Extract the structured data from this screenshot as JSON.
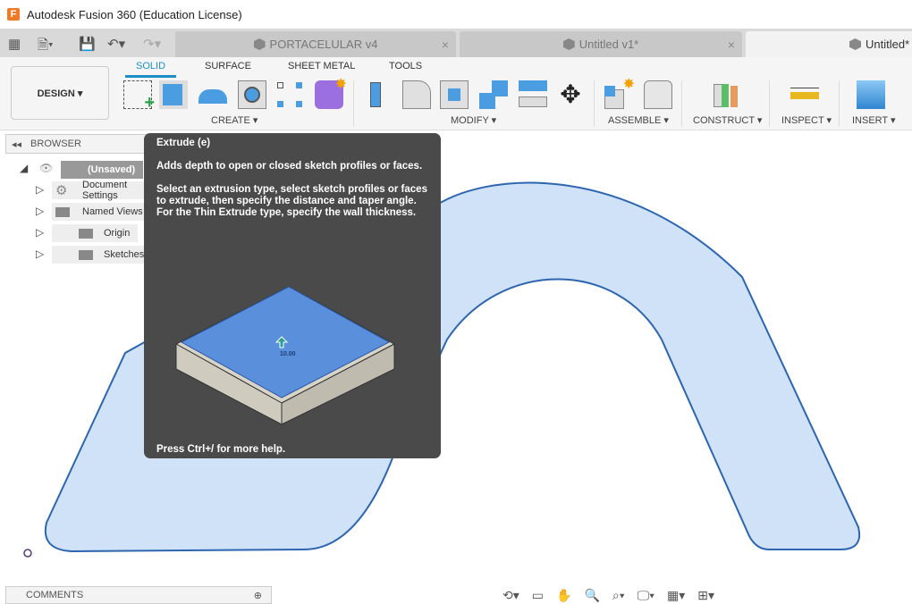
{
  "window": {
    "title": "Autodesk Fusion 360 (Education License)",
    "logo": "F"
  },
  "tabs": [
    {
      "label": "PORTACELULAR v4",
      "close": "×"
    },
    {
      "label": "Untitled v1*",
      "close": "×"
    },
    {
      "label": "Untitled*"
    }
  ],
  "ribbon": {
    "workspace": "DESIGN ▾",
    "tabs": [
      "SOLID",
      "SURFACE",
      "SHEET METAL",
      "TOOLS"
    ],
    "groups": [
      "CREATE ▾",
      "MODIFY ▾",
      "ASSEMBLE ▾",
      "CONSTRUCT ▾",
      "INSPECT ▾",
      "INSERT ▾"
    ]
  },
  "browser": {
    "title": "BROWSER",
    "root": "(Unsaved)",
    "items": [
      "Document Settings",
      "Named Views",
      "Origin",
      "Sketches"
    ]
  },
  "tooltip": {
    "title": "Extrude (e)",
    "desc1": "Adds depth to open or closed sketch profiles or faces.",
    "desc2": "Select an extrusion type, select sketch profiles or faces to extrude, then specify the distance and taper angle. For the Thin Extrude type, specify the wall thickness.",
    "dimension": "10.00",
    "footer": "Press Ctrl+/ for more help."
  },
  "comments": {
    "label": "COMMENTS"
  },
  "colors": {
    "accent": "#1e8fc6",
    "body_fill": "#cfe2f7",
    "body_stroke": "#2d65b0",
    "tooltip_bg": "#4a4a4a"
  }
}
